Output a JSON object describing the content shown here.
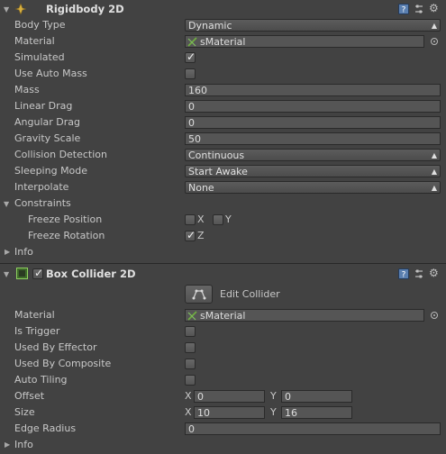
{
  "rigidbody": {
    "title": "Rigidbody 2D",
    "body_type": {
      "label": "Body Type",
      "value": "Dynamic"
    },
    "material": {
      "label": "Material",
      "value": "sMaterial"
    },
    "simulated": {
      "label": "Simulated",
      "checked": true
    },
    "use_auto_mass": {
      "label": "Use Auto Mass",
      "checked": false
    },
    "mass": {
      "label": "Mass",
      "value": "160"
    },
    "linear_drag": {
      "label": "Linear Drag",
      "value": "0"
    },
    "angular_drag": {
      "label": "Angular Drag",
      "value": "0"
    },
    "gravity_scale": {
      "label": "Gravity Scale",
      "value": "50"
    },
    "collision_detection": {
      "label": "Collision Detection",
      "value": "Continuous"
    },
    "sleeping_mode": {
      "label": "Sleeping Mode",
      "value": "Start Awake"
    },
    "interpolate": {
      "label": "Interpolate",
      "value": "None"
    },
    "constraints": {
      "label": "Constraints",
      "freeze_position": {
        "label": "Freeze Position",
        "x_label": "X",
        "y_label": "Y",
        "x": false,
        "y": false
      },
      "freeze_rotation": {
        "label": "Freeze Rotation",
        "z_label": "Z",
        "z": true
      }
    },
    "info": {
      "label": "Info"
    }
  },
  "box_collider": {
    "title": "Box Collider 2D",
    "enabled": true,
    "edit_collider": {
      "label": "Edit Collider"
    },
    "material": {
      "label": "Material",
      "value": "sMaterial"
    },
    "is_trigger": {
      "label": "Is Trigger",
      "checked": false
    },
    "used_by_effector": {
      "label": "Used By Effector",
      "checked": false
    },
    "used_by_composite": {
      "label": "Used By Composite",
      "checked": false
    },
    "auto_tiling": {
      "label": "Auto Tiling",
      "checked": false
    },
    "offset": {
      "label": "Offset",
      "x_label": "X",
      "y_label": "Y",
      "x": "0",
      "y": "0"
    },
    "size": {
      "label": "Size",
      "x_label": "X",
      "y_label": "Y",
      "x": "10",
      "y": "16"
    },
    "edge_radius": {
      "label": "Edge Radius",
      "value": "0"
    },
    "info": {
      "label": "Info"
    }
  },
  "icons": [
    "rigidbody-icon",
    "help-icon",
    "preset-icon",
    "settings-icon",
    "box-collider-icon",
    "edit-collider-icon",
    "material-icon",
    "object-picker-icon"
  ]
}
